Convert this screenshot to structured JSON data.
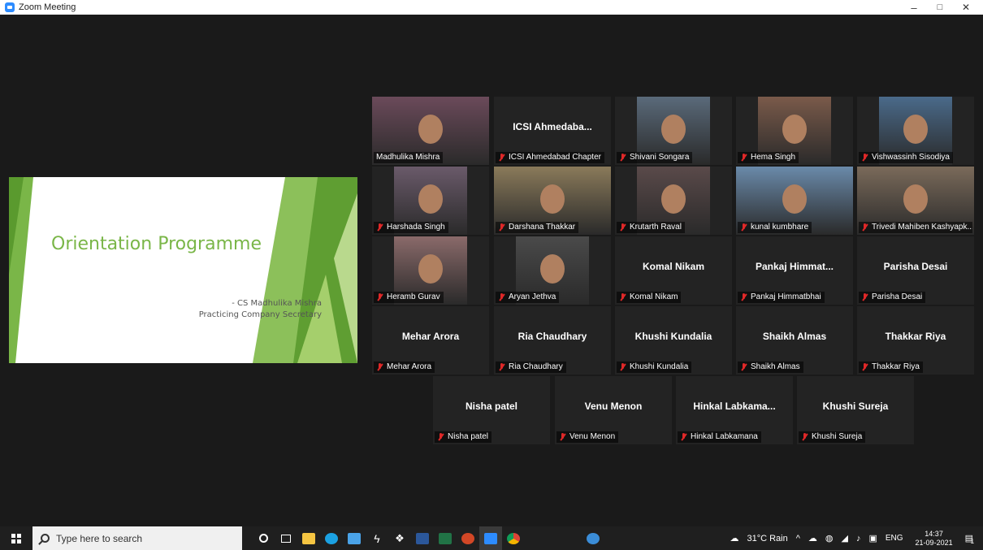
{
  "window": {
    "title": "Zoom Meeting",
    "minimize": "–",
    "maximize": "□",
    "close": "✕"
  },
  "shared_screen": {
    "title": "Orientation Programme",
    "presenter": "- CS Madhulika Mishra",
    "designation": "Practicing Company Secretary"
  },
  "participants": [
    {
      "name": "Madhulika Mishra",
      "display": "",
      "muted": false,
      "video": true,
      "active": true
    },
    {
      "name": "ICSI Ahmedabad Chapter",
      "display": "ICSI  Ahmedaba...",
      "muted": true,
      "video": false
    },
    {
      "name": "Shivani Songara",
      "display": "",
      "muted": true,
      "video": true
    },
    {
      "name": "Hema Singh",
      "display": "",
      "muted": true,
      "video": true
    },
    {
      "name": "Vishwassinh Sisodiya",
      "display": "",
      "muted": true,
      "video": true
    },
    {
      "name": "Harshada Singh",
      "display": "",
      "muted": true,
      "video": true
    },
    {
      "name": "Darshana Thakkar",
      "display": "",
      "muted": true,
      "video": true
    },
    {
      "name": "Krutarth Raval",
      "display": "",
      "muted": true,
      "video": true
    },
    {
      "name": "kunal kumbhare",
      "display": "",
      "muted": true,
      "video": true
    },
    {
      "name": "Trivedi Mahiben Kashyapk...",
      "display": "",
      "muted": true,
      "video": true
    },
    {
      "name": "Heramb Gurav",
      "display": "",
      "muted": true,
      "video": true
    },
    {
      "name": "Aryan Jethva",
      "display": "",
      "muted": true,
      "video": true
    },
    {
      "name": "Komal Nikam",
      "display": "Komal Nikam",
      "muted": true,
      "video": false
    },
    {
      "name": "Pankaj Himmatbhai",
      "display": "Pankaj  Himmat...",
      "muted": true,
      "video": false
    },
    {
      "name": "Parisha Desai",
      "display": "Parisha Desai",
      "muted": true,
      "video": false
    },
    {
      "name": "Mehar Arora",
      "display": "Mehar Arora",
      "muted": true,
      "video": false
    },
    {
      "name": "Ria Chaudhary",
      "display": "Ria Chaudhary",
      "muted": true,
      "video": false
    },
    {
      "name": "Khushi Kundalia",
      "display": "Khushi Kundalia",
      "muted": true,
      "video": false
    },
    {
      "name": "Shaikh Almas",
      "display": "Shaikh Almas",
      "muted": true,
      "video": false
    },
    {
      "name": "Thakkar Riya",
      "display": "Thakkar Riya",
      "muted": true,
      "video": false
    },
    {
      "name": "Nisha patel",
      "display": "Nisha patel",
      "muted": true,
      "video": false
    },
    {
      "name": "Venu Menon",
      "display": "Venu Menon",
      "muted": true,
      "video": false
    },
    {
      "name": "Hinkal Labkamana",
      "display": "Hinkal  Labkama...",
      "muted": true,
      "video": false
    },
    {
      "name": "Khushi Sureja",
      "display": "Khushi Sureja",
      "muted": true,
      "video": false
    }
  ],
  "taskbar": {
    "search_placeholder": "Type here to search",
    "apps": [
      "cortana-icon",
      "task-view-icon",
      "file-explorer-icon",
      "edge-icon",
      "mail-icon",
      "winamp-icon",
      "dropbox-icon",
      "word-icon",
      "excel-icon",
      "powerpoint-icon",
      "zoom-icon",
      "chrome-icon",
      "help-icon"
    ],
    "weather": "31°C  Rain",
    "language": "ENG",
    "time": "14:37",
    "date": "21-09-2021",
    "notification_count": "1"
  },
  "colors": {
    "active_speaker": "#d6e84a",
    "muted": "#e02828",
    "slide_accent": "#7ab648"
  }
}
